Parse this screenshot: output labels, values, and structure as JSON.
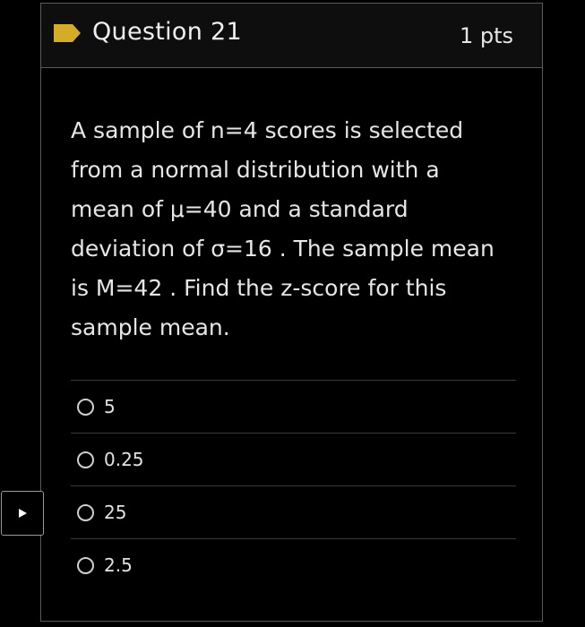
{
  "question": {
    "title": "Question 21",
    "points": "1 pts",
    "text": "A sample of n=4 scores is selected\nfrom a normal distribution with a\nmean of μ=40 and a standard\ndeviation of σ=16 . The sample mean\nis M=42 . Find the z-score for this\nsample mean."
  },
  "answers": [
    {
      "label": "5"
    },
    {
      "label": "0.25"
    },
    {
      "label": "25"
    },
    {
      "label": "2.5"
    }
  ],
  "colors": {
    "flag": "#d4ac2a",
    "background": "#000000",
    "border": "#5a5a5a"
  },
  "icons": {
    "flag": "bookmark-flag-icon",
    "side": "play-triangle-icon"
  }
}
